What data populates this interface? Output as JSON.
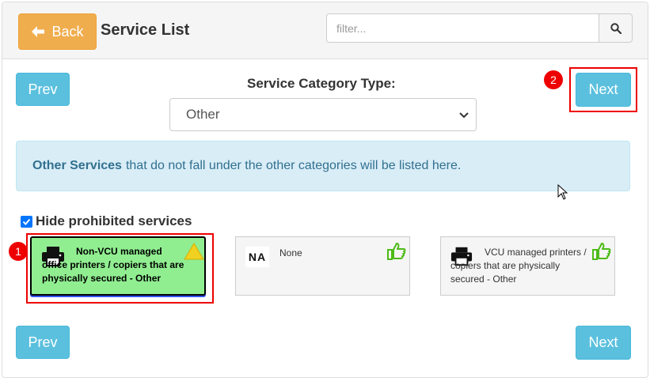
{
  "header": {
    "back_label": "Back",
    "title": "Service List",
    "filter_placeholder": "filter..."
  },
  "nav": {
    "prev_label": "Prev",
    "next_label": "Next"
  },
  "category": {
    "label": "Service Category Type:",
    "selected": "Other"
  },
  "info": {
    "bold": "Other Services",
    "text": "that do not fall under the other categories will be listed here."
  },
  "hide_prohibited": {
    "label": "Hide prohibited services",
    "checked": true
  },
  "services": [
    {
      "text": "Non-VCU managed office printers / copiers that are physically secured - Other",
      "icon": "printer-icon",
      "status": "warning-icon",
      "selected": true
    },
    {
      "logo": "NA",
      "text": "None",
      "status": "thumbs-up-icon",
      "selected": false
    },
    {
      "text": "VCU managed printers / copiers that are physically secured - Other",
      "icon": "printer-icon",
      "status": "thumbs-up-icon",
      "selected": false
    }
  ],
  "annotations": [
    "1",
    "2"
  ],
  "colors": {
    "back_button": "#f0ad4e",
    "info_button": "#5bc0de",
    "alert_bg": "#d9edf7",
    "alert_text": "#31708f",
    "selected_card": "#90ee90",
    "highlight": "#ee0000",
    "thumb": "#4cbb17"
  }
}
